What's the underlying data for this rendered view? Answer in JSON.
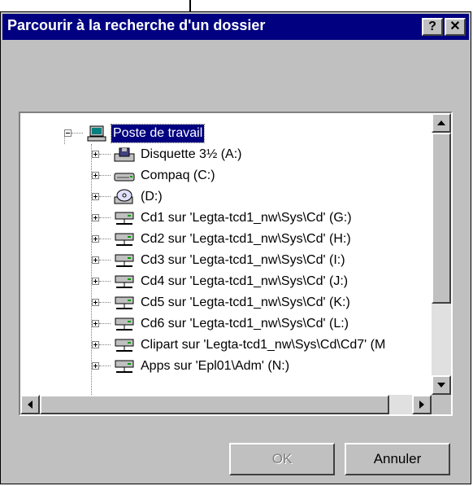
{
  "window": {
    "title": "Parcourir à la recherche d'un dossier",
    "help_label": "?",
    "close_label": "✕"
  },
  "tree": {
    "root": {
      "label": "Poste de travail",
      "icon": "computer-icon",
      "selected": true
    },
    "items": [
      {
        "label": "Disquette 3½ (A:)",
        "icon": "floppy-drive-icon"
      },
      {
        "label": "Compaq (C:)",
        "icon": "hard-drive-icon"
      },
      {
        "label": "(D:)",
        "icon": "cd-drive-icon"
      },
      {
        "label": "Cd1 sur 'Legta-tcd1_nw\\Sys\\Cd' (G:)",
        "icon": "network-drive-icon"
      },
      {
        "label": "Cd2 sur 'Legta-tcd1_nw\\Sys\\Cd' (H:)",
        "icon": "network-drive-icon"
      },
      {
        "label": "Cd3 sur 'Legta-tcd1_nw\\Sys\\Cd' (I:)",
        "icon": "network-drive-icon"
      },
      {
        "label": "Cd4 sur 'Legta-tcd1_nw\\Sys\\Cd' (J:)",
        "icon": "network-drive-icon"
      },
      {
        "label": "Cd5 sur 'Legta-tcd1_nw\\Sys\\Cd' (K:)",
        "icon": "network-drive-icon"
      },
      {
        "label": "Cd6 sur 'Legta-tcd1_nw\\Sys\\Cd' (L:)",
        "icon": "network-drive-icon"
      },
      {
        "label": "Clipart sur 'Legta-tcd1_nw\\Sys\\Cd\\Cd7' (M",
        "icon": "network-drive-icon"
      },
      {
        "label": "Apps sur 'Epl01\\Adm' (N:)",
        "icon": "network-drive-icon"
      }
    ]
  },
  "buttons": {
    "ok_label": "OK",
    "cancel_label": "Annuler"
  },
  "colors": {
    "titlebar": "#000080",
    "selection": "#000080",
    "face": "#c0c0c0"
  }
}
